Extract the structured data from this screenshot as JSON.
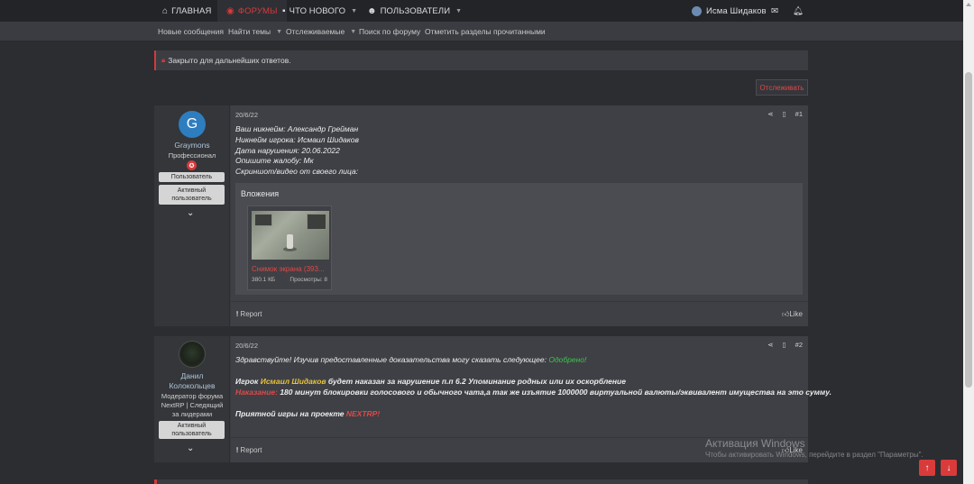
{
  "nav": {
    "home": "ГЛАВНАЯ",
    "forums": "ФОРУМЫ",
    "whats_new": "ЧТО НОВОГО",
    "users": "ПОЛЬЗОВАТЕЛИ",
    "username": "Исма Шидаков"
  },
  "subnav": [
    "Новые сообщения",
    "Найти темы",
    "Отслеживаемые",
    "Поиск по форуму",
    "Отметить разделы прочитанными"
  ],
  "notice": "Закрыто для дальнейших ответов.",
  "watch_button": "Отслеживать",
  "post1": {
    "avatar_letter": "G",
    "username": "Graymons",
    "title": "Профессионал",
    "badges": [
      "Пользователь",
      "Активный пользователь"
    ],
    "date": "20/6/22",
    "number": "#1",
    "lines": [
      "Ваш никнейм: Александр Грейман",
      "Никнейм игрока: Исмаил Шидаков",
      "Дата нарушения: 20.06.2022",
      "Опишите жалобу: Мк",
      "Скриншот/видео от своего лица:"
    ],
    "attachments_title": "Вложения",
    "attachment": {
      "name": "Снимок экрана (393...",
      "size": "380.1 КБ",
      "views": "Просмотры: 8"
    },
    "report": "Report",
    "like": "Like"
  },
  "post2": {
    "username_line1": "Данил",
    "username_line2": "Колокольцев",
    "title_lines": [
      "Модератор форума",
      "NextRP | Следящий",
      "за лидерами"
    ],
    "badge": "Активный пользователь",
    "date": "20/6/22",
    "number": "#2",
    "line1_prefix": "Здравствуйте! Изучив предоставленные доказательства могу сказать следующее: ",
    "line1_status": "Одобрено!",
    "line2_prefix": "Игрок ",
    "line2_name": "Исмаил Шидаков",
    "line2_suffix": " будет наказан за нарушение п.п 6.2 Упоминание родных или их оскорбление",
    "line3_label": "Наказание:",
    "line3_text": " 180 минут блокировки голосового и обычного чата,а так же изъятие 1000000 виртуальной валюты/эквивалент имущества на это сумму.",
    "line4_prefix": "Приятной игры на проекте ",
    "line4_project": "NEXTRP!",
    "report": "Report",
    "like": "Like"
  },
  "watermark": {
    "title": "Активация Windows",
    "subtitle": "Чтобы активировать Windows, перейдите в раздел \"Параметры\"."
  },
  "colors": {
    "accent": "#d83a3a",
    "approved": "#3fc44a",
    "name_highlight": "#e8c33a"
  }
}
